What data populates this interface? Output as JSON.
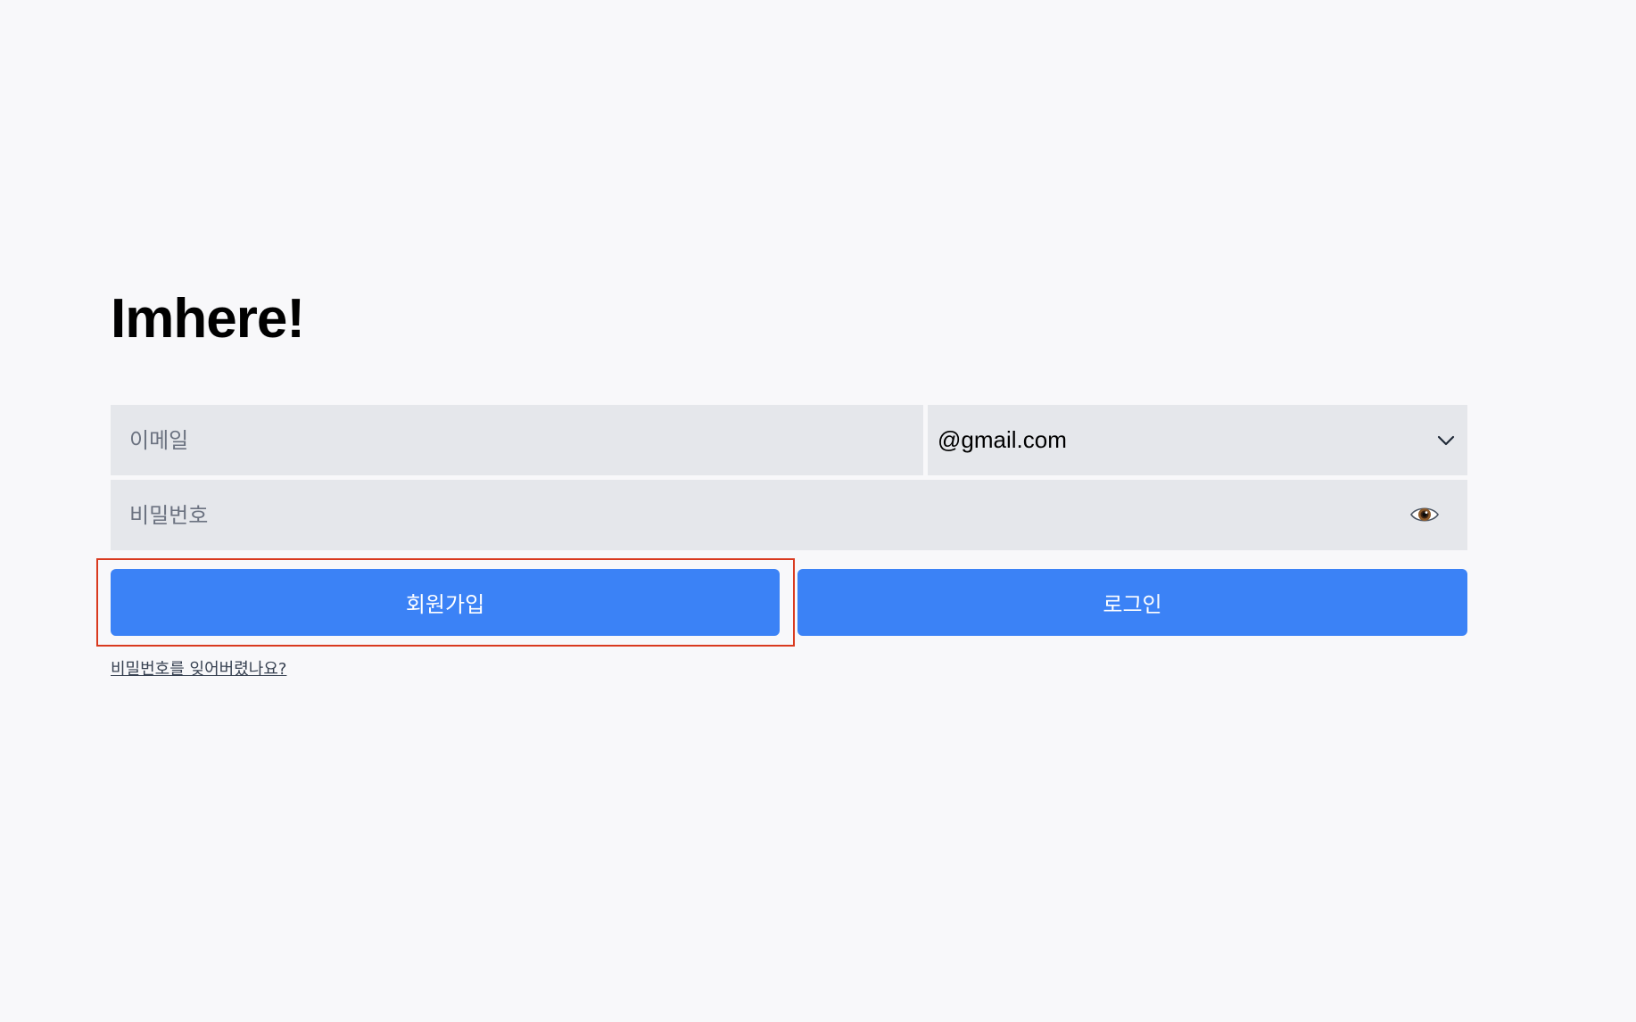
{
  "app": {
    "title": "Imhere!"
  },
  "login_form": {
    "email": {
      "placeholder": "이메일",
      "value": ""
    },
    "domain_select": {
      "selected": "@gmail.com",
      "icon": "chevron-down-icon"
    },
    "password": {
      "placeholder": "비밀번호",
      "value": "",
      "toggle_icon": "eye-icon"
    },
    "signup_label": "회원가입",
    "login_label": "로그인",
    "forgot_password_label": "비밀번호를 잊어버렸나요?"
  },
  "colors": {
    "background": "#f8f8fa",
    "input_background": "#e5e7eb",
    "primary_button": "#3b82f6",
    "highlight_border": "#d93a1f"
  }
}
